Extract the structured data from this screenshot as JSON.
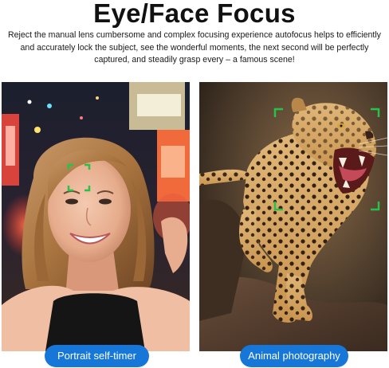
{
  "header": {
    "title": "Eye/Face Focus",
    "description": "Reject the manual lens cumbersome and complex focusing experience autofocus helps to efficiently and accurately lock the subject, see the wonderful moments, the next second will be perfectly captured, and steadily grasp every – a famous scene!"
  },
  "panels": [
    {
      "label": "Portrait self-timer",
      "subject": "woman-selfie-photo",
      "focus_box": "eye"
    },
    {
      "label": "Animal photography",
      "subject": "leopard-photo",
      "focus_box": "face"
    }
  ],
  "colors": {
    "accent": "#1677d9",
    "focus_box": "#27c24a",
    "title": "#111111"
  }
}
